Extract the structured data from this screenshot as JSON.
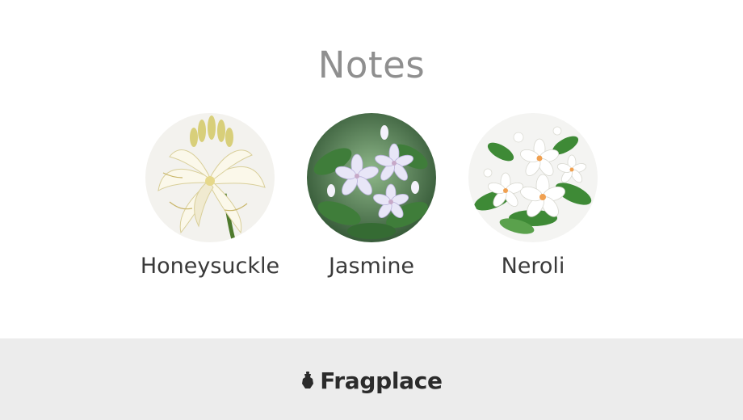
{
  "section": {
    "title": "Notes"
  },
  "notes": [
    {
      "label": "Honeysuckle",
      "image": "honeysuckle-flower-image"
    },
    {
      "label": "Jasmine",
      "image": "jasmine-flower-image"
    },
    {
      "label": "Neroli",
      "image": "neroli-flower-image"
    }
  ],
  "footer": {
    "brand_name": "Fragplace",
    "logo_icon": "bottle-icon"
  },
  "colors": {
    "title": "#8f8f8f",
    "label": "#3a3a3a",
    "footer_bg": "#ececec",
    "brand": "#2b2b2b"
  }
}
